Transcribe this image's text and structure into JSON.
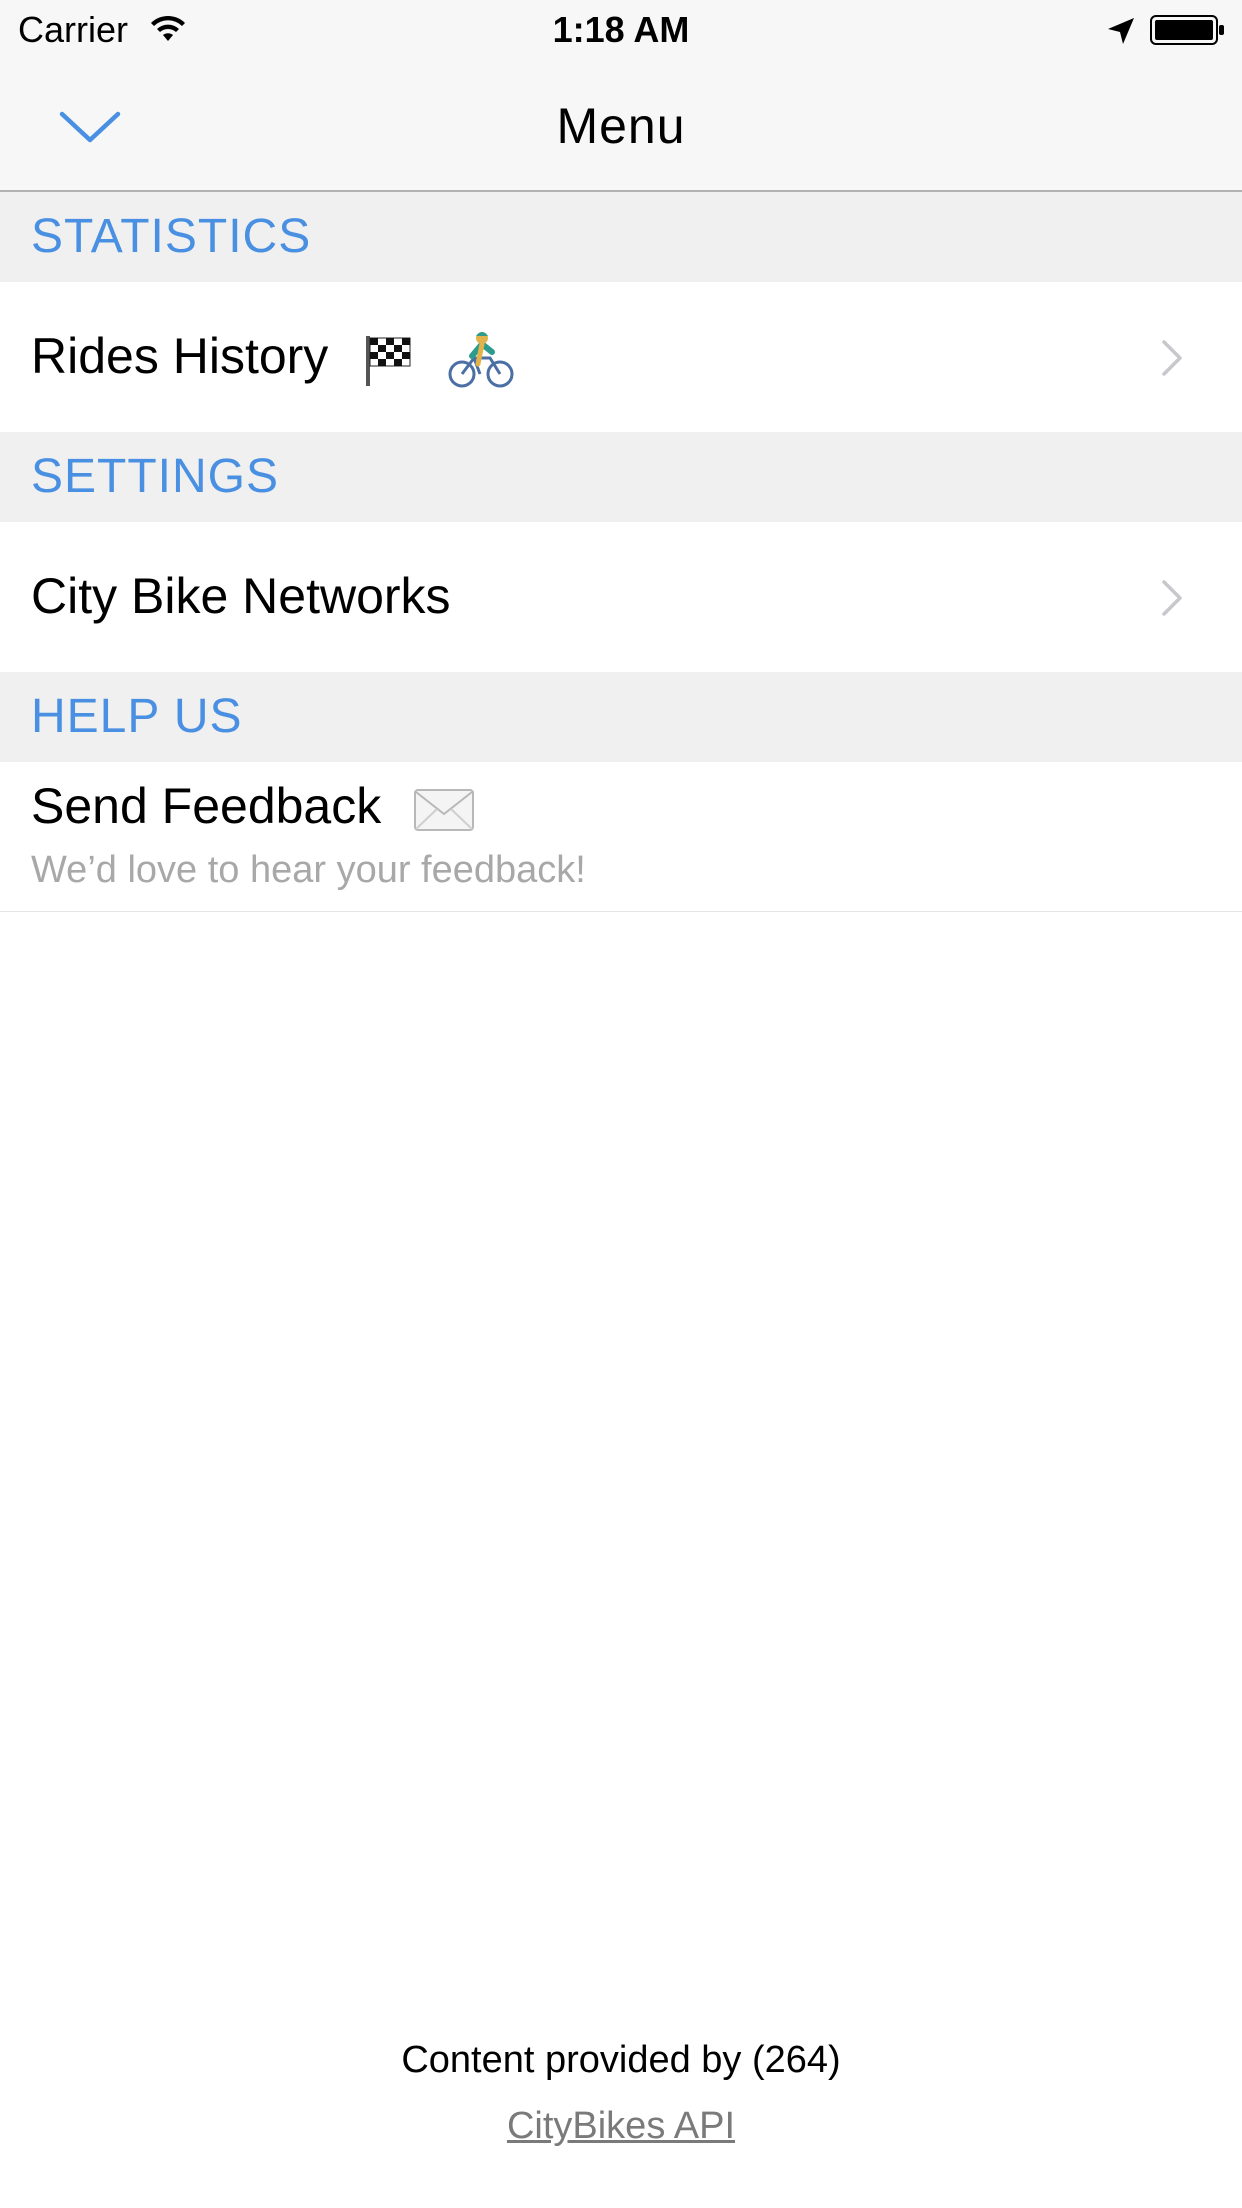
{
  "status_bar": {
    "carrier": "Carrier",
    "time": "1:18 AM"
  },
  "nav": {
    "title": "Menu",
    "dismiss_icon": "chevron-down-icon"
  },
  "sections": [
    {
      "header": "STATISTICS",
      "rows": [
        {
          "label": "Rides History",
          "icons": [
            "checkered-flag-icon",
            "cyclist-icon"
          ],
          "accessory": "chevron-right-icon"
        }
      ]
    },
    {
      "header": "SETTINGS",
      "rows": [
        {
          "label": "City Bike Networks",
          "accessory": "chevron-right-icon"
        }
      ]
    },
    {
      "header": "HELP US",
      "rows": [
        {
          "label": "Send Feedback",
          "icons": [
            "envelope-icon"
          ],
          "subtitle": "We’d love to hear your feedback!"
        }
      ]
    }
  ],
  "footer": {
    "text": "Content provided by (264)",
    "link": "CityBikes API"
  },
  "colors": {
    "accent": "#4a90e2",
    "section_bg": "#f0f0f0",
    "subtitle": "#a8a8a8",
    "link": "#7a7a7a"
  }
}
